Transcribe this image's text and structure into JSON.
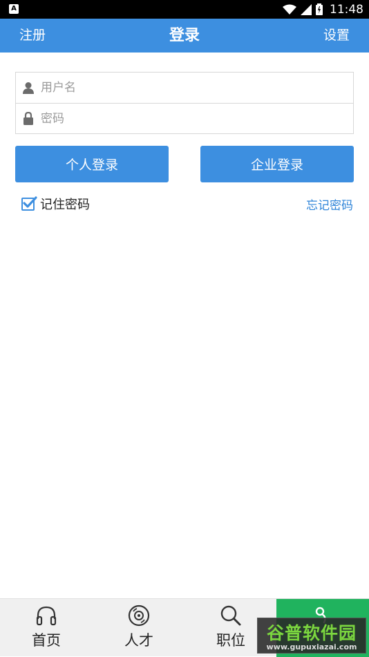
{
  "status_bar": {
    "notification_icon": "A",
    "time": "11:48"
  },
  "header": {
    "left_label": "注册",
    "title": "登录",
    "right_label": "设置"
  },
  "form": {
    "username_placeholder": "用户名",
    "username_value": "",
    "password_placeholder": "密码",
    "password_value": ""
  },
  "buttons": {
    "personal_login": "个人登录",
    "company_login": "企业登录"
  },
  "options": {
    "remember_password": "记住密码",
    "remember_checked": true,
    "forgot_password": "忘记密码"
  },
  "tabbar": {
    "items": [
      {
        "label": "首页",
        "icon": "headphones-icon"
      },
      {
        "label": "人才",
        "icon": "disc-icon"
      },
      {
        "label": "职位",
        "icon": "search-icon"
      },
      {
        "label": "",
        "icon": "app-icon"
      }
    ]
  },
  "watermark": {
    "logo_text": "谷普软件园",
    "url": "www.gupuxiazai.com"
  },
  "colors": {
    "primary": "#3d8fe0",
    "link": "#2f84d8",
    "active_tab": "#20b35e"
  }
}
